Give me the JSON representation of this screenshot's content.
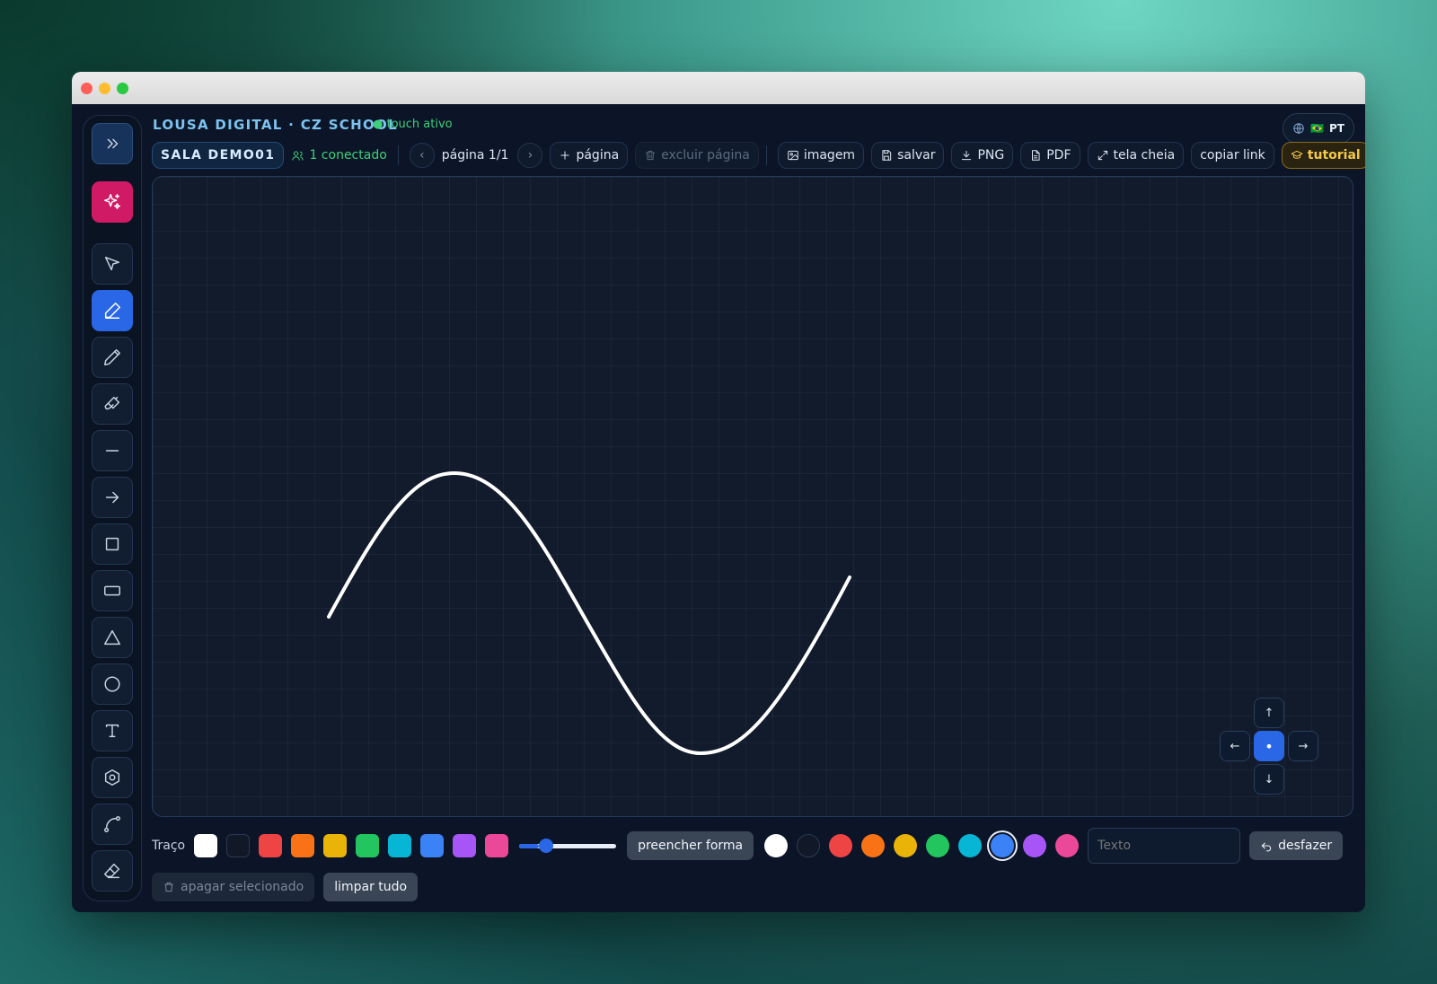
{
  "app": {
    "title": "LOUSA DIGITAL · CZ SCHOOL",
    "touch_status": "● touch ativo",
    "language_flag": "🇧🇷",
    "language_code": "PT"
  },
  "toolbar": {
    "room": "SALA DEMO01",
    "connected": "1 conectado",
    "prev_icon": "‹",
    "next_icon": "›",
    "page_label": "página 1/1",
    "add_page": "página",
    "delete_page": "excluir página",
    "image": "imagem",
    "save": "salvar",
    "png": "PNG",
    "pdf": "PDF",
    "fullscreen": "tela cheia",
    "copy_link": "copiar link",
    "tutorial": "tutorial"
  },
  "sidebar": {
    "tools": [
      {
        "name": "expand",
        "icon": "chevrons-right-icon"
      },
      {
        "name": "ai",
        "icon": "sparkles-icon"
      },
      {
        "name": "select",
        "icon": "pointer-icon"
      },
      {
        "name": "pen",
        "icon": "pen-icon",
        "active": true
      },
      {
        "name": "pencil",
        "icon": "pencil-icon"
      },
      {
        "name": "brush",
        "icon": "brush-icon"
      },
      {
        "name": "line",
        "icon": "minus-icon"
      },
      {
        "name": "arrow",
        "icon": "arrow-right-icon"
      },
      {
        "name": "square",
        "icon": "square-icon"
      },
      {
        "name": "rectangle",
        "icon": "rectangle-icon"
      },
      {
        "name": "triangle",
        "icon": "triangle-icon"
      },
      {
        "name": "circle",
        "icon": "circle-icon"
      },
      {
        "name": "text",
        "icon": "type-icon"
      },
      {
        "name": "polygon",
        "icon": "hexagon-icon"
      },
      {
        "name": "curve",
        "icon": "spline-icon"
      },
      {
        "name": "eraser",
        "icon": "eraser-icon"
      }
    ]
  },
  "canvas": {
    "stroke_color": "#ffffff",
    "pan": {
      "up": "↑",
      "down": "↓",
      "left": "←",
      "right": "→",
      "center": "•"
    }
  },
  "bottom": {
    "stroke_label": "Traço",
    "stroke_colors": [
      "#ffffff",
      "#111827",
      "#ef4444",
      "#f97316",
      "#eab308",
      "#22c55e",
      "#06b6d4",
      "#3b82f6",
      "#a855f7",
      "#ec4899"
    ],
    "stroke_width_fraction": 0.2,
    "fill_shape": "preencher forma",
    "fill_colors": [
      "#ffffff",
      "#111827",
      "#ef4444",
      "#f97316",
      "#eab308",
      "#22c55e",
      "#06b6d4",
      "#3b82f6",
      "#a855f7",
      "#ec4899"
    ],
    "fill_selected_index": 7,
    "text_placeholder": "Texto",
    "undo": "desfazer",
    "delete_selected": "apagar selecionado",
    "clear_all": "limpar tudo"
  }
}
